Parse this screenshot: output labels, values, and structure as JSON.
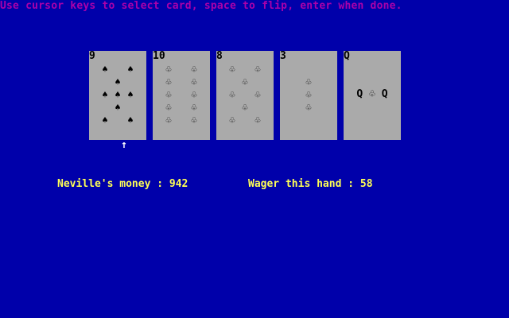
{
  "instructions": "Use cursor keys to select card, space to flip, enter when done.",
  "colors": {
    "background": "#0000aa",
    "instructions_text": "#aa00aa",
    "card_face": "#aaaaaa",
    "status_text": "#ffff55",
    "cursor": "#ffffff"
  },
  "cards": [
    {
      "rank": "9",
      "suit": "spades",
      "suit_icon": "spade-solid-icon"
    },
    {
      "rank": "10",
      "suit": "clubs",
      "suit_icon": "club-outline-icon"
    },
    {
      "rank": "8",
      "suit": "clubs",
      "suit_icon": "club-outline-icon"
    },
    {
      "rank": "3",
      "suit": "clubs",
      "suit_icon": "club-outline-icon"
    },
    {
      "rank": "Q",
      "suit": "clubs",
      "suit_icon": "club-outline-icon",
      "court_label": "Q ♧ Q"
    }
  ],
  "selected_card_index": 0,
  "cursor_symbol": "↑",
  "player": {
    "money_label": "Neville's money : 942",
    "wager_label": "Wager this hand : 58"
  }
}
